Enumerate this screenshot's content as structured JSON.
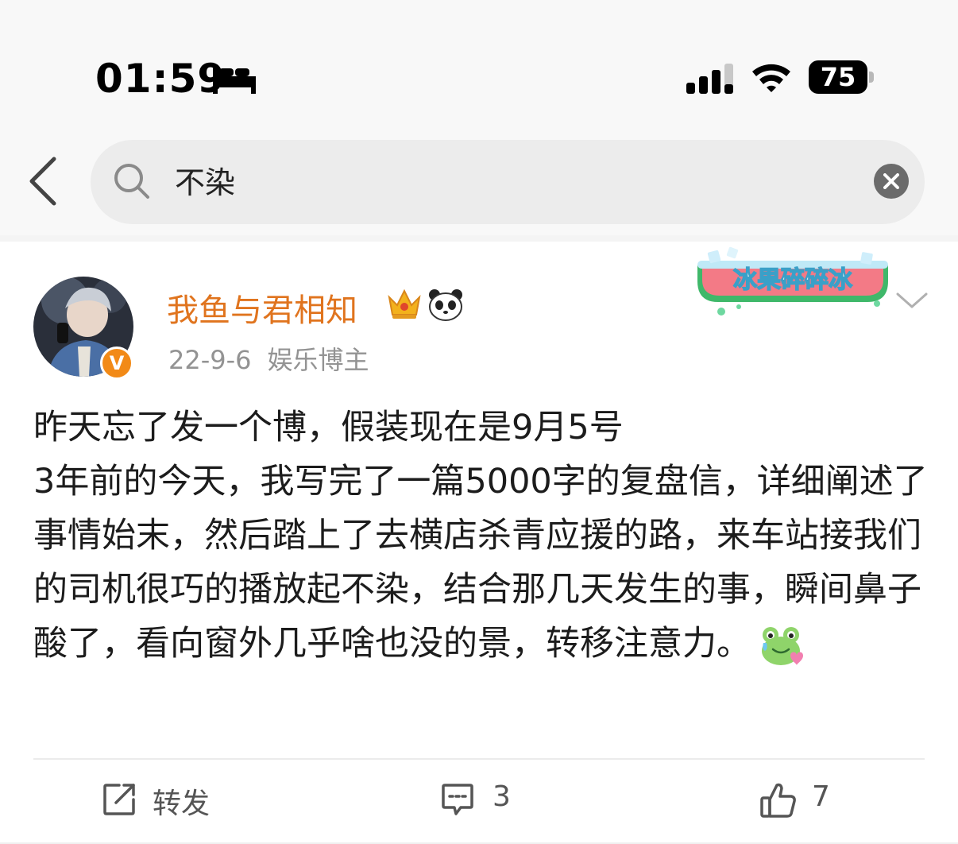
{
  "status_bar": {
    "time": "01:59",
    "battery": "75",
    "icons": [
      "bed-icon",
      "signal-icon",
      "wifi-icon",
      "battery-icon"
    ]
  },
  "search": {
    "query": "不染",
    "icons": [
      "back-icon",
      "search-icon",
      "clear-icon"
    ]
  },
  "post": {
    "username": "我鱼与君相知",
    "date": "22-9-6",
    "role": "娱乐博主",
    "verified_badge": "V",
    "sticker_text": "冰果碎碎冰",
    "body_lines": [
      "昨天忘了发一个博，假装现在是9月5号",
      "3年前的今天，我写完了一篇5000字的复盘信，详细阐述了事情始末，然后踏上了去横店杀青应援的路，来车站接我们的司机很巧的播放起不染，结合那几天发生的事，瞬间鼻子酸了，看向窗外几乎啥也没的景，转移注意力。"
    ],
    "colors": {
      "username": "#e0741e",
      "verified": "#f28a17",
      "meta": "#939393"
    }
  },
  "actions": {
    "repost_label": "转发",
    "comment_count": "3",
    "like_count": "7"
  }
}
